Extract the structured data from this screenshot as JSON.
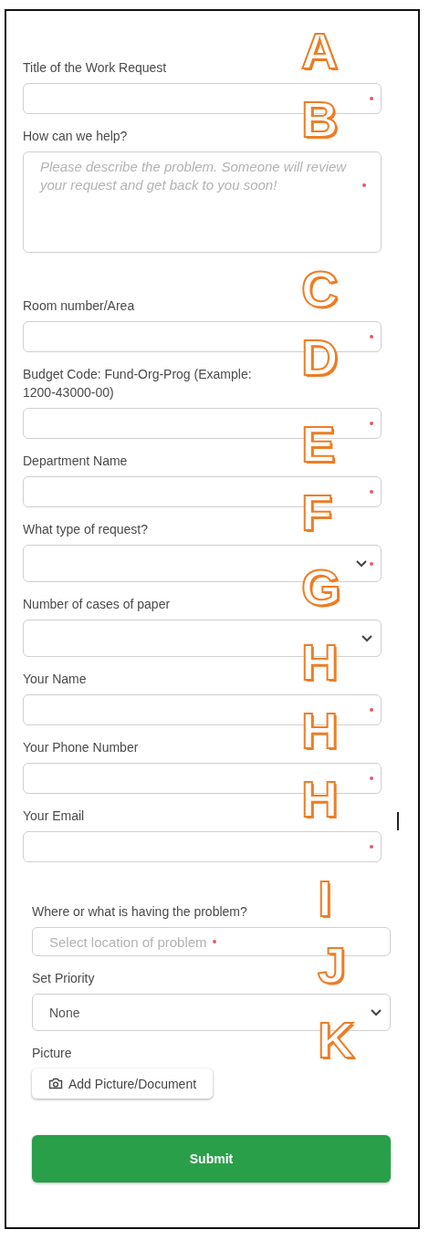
{
  "request_fields": [
    {
      "label": "Title of the Work Request",
      "kind": "text",
      "required": true,
      "annotation": "A"
    },
    {
      "label": "How can we help?",
      "kind": "textarea",
      "placeholder": "Please describe the problem. Someone will review your request and get back to you soon!",
      "required": true,
      "annotation": "B"
    },
    {
      "label": "Room number/Area",
      "kind": "text",
      "required": true,
      "annotation": "C"
    },
    {
      "label": "Budget Code: Fund-Org-Prog (Example: 1200-43000-00)",
      "kind": "text",
      "required": true,
      "annotation": "D"
    },
    {
      "label": "Department Name",
      "kind": "text",
      "required": true,
      "annotation": "E"
    },
    {
      "label": "What type of request?",
      "kind": "select",
      "required": true,
      "annotation": "F"
    },
    {
      "label": "Number of cases of paper",
      "kind": "select",
      "required": false,
      "annotation": "G"
    },
    {
      "label": "Your Name",
      "kind": "text",
      "required": true,
      "annotation": "H"
    },
    {
      "label": "Your Phone Number",
      "kind": "text",
      "required": true,
      "annotation": "H"
    },
    {
      "label": "Your Email",
      "kind": "text",
      "required": true,
      "annotation": "H"
    }
  ],
  "location_fields": [
    {
      "label": "Where or what is having the problem?",
      "kind": "picker",
      "placeholder": "Select location of problem",
      "required": true,
      "annotation": "I"
    },
    {
      "label": "Set Priority",
      "kind": "select",
      "value": "None",
      "required": false,
      "annotation": "J"
    },
    {
      "label": "Picture",
      "kind": "upload",
      "button_label": "Add Picture/Document",
      "annotation": "K"
    }
  ],
  "submit_button": "Submit"
}
